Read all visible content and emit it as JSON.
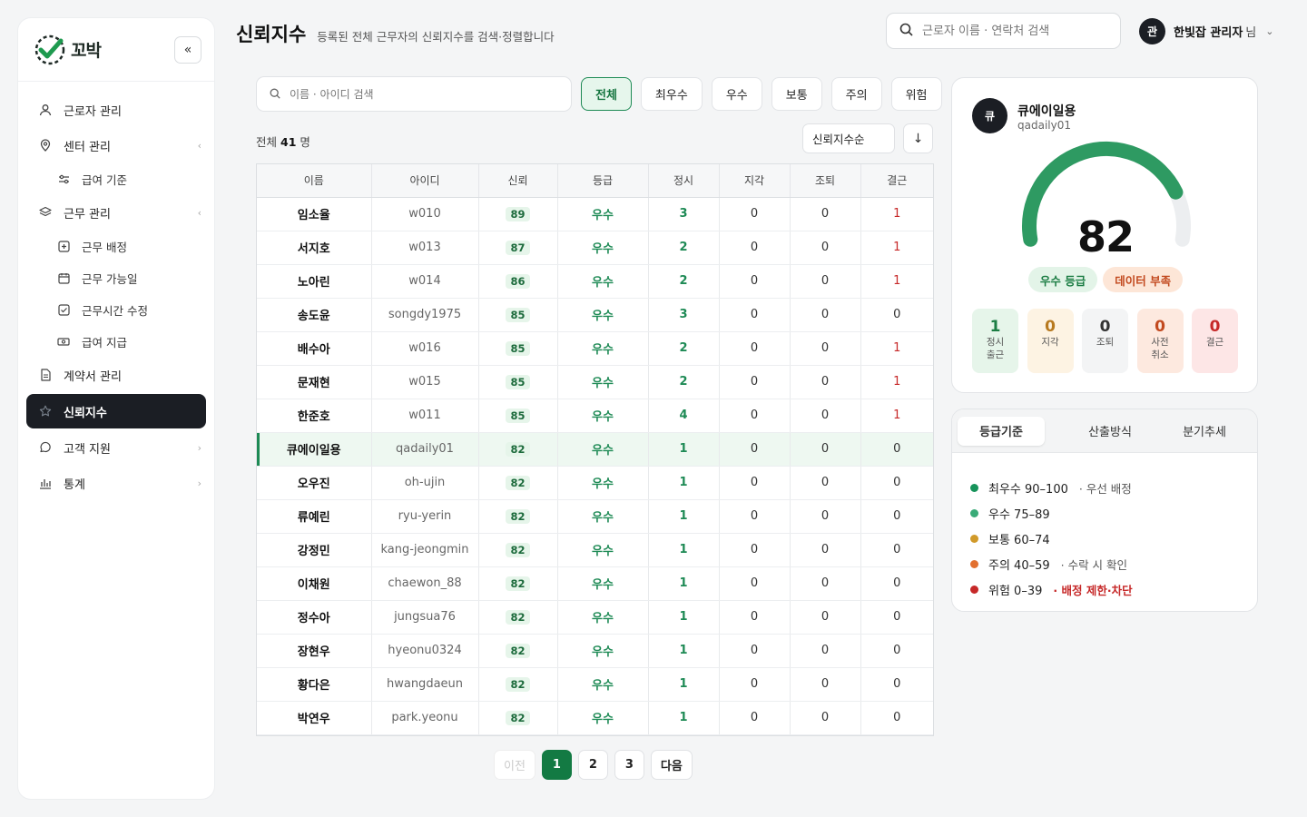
{
  "app": {
    "logo_text": "꼬박"
  },
  "sidebar": {
    "items": [
      {
        "label": "근로자 관리"
      },
      {
        "label": "센터 관리"
      },
      {
        "label": "급여 기준"
      },
      {
        "label": "근무 관리"
      },
      {
        "label": "근무 배정"
      },
      {
        "label": "근무 가능일"
      },
      {
        "label": "근무시간 수정"
      },
      {
        "label": "급여 지급"
      },
      {
        "label": "계약서 관리"
      },
      {
        "label": "신뢰지수"
      },
      {
        "label": "고객 지원"
      },
      {
        "label": "통계"
      }
    ]
  },
  "header": {
    "title": "신뢰지수",
    "subtitle": "등록된 전체 근무자의 신뢰지수를 검색·정렬합니다",
    "search_placeholder": "근로자 이름 · 연락처 검색",
    "user_initial": "관",
    "user_name": "한빛잡 관리자",
    "user_suffix": "님"
  },
  "list": {
    "search_placeholder": "이름 · 아이디 검색",
    "filters": [
      "전체",
      "최우수",
      "우수",
      "보통",
      "주의",
      "위험"
    ],
    "total_prefix": "전체",
    "total_count": "41",
    "total_suffix": "명",
    "sort_label": "신뢰지수순",
    "columns": [
      "이름",
      "아이디",
      "신뢰",
      "등급",
      "정시",
      "지각",
      "조퇴",
      "결근"
    ],
    "rows": [
      {
        "name": "임소율",
        "id": "w010",
        "score": "89",
        "grade": "우수",
        "ontime": "3",
        "late": "0",
        "early": "0",
        "absent": "1"
      },
      {
        "name": "서지호",
        "id": "w013",
        "score": "87",
        "grade": "우수",
        "ontime": "2",
        "late": "0",
        "early": "0",
        "absent": "1"
      },
      {
        "name": "노아린",
        "id": "w014",
        "score": "86",
        "grade": "우수",
        "ontime": "2",
        "late": "0",
        "early": "0",
        "absent": "1"
      },
      {
        "name": "송도윤",
        "id": "songdy1975",
        "score": "85",
        "grade": "우수",
        "ontime": "3",
        "late": "0",
        "early": "0",
        "absent": "0"
      },
      {
        "name": "배수아",
        "id": "w016",
        "score": "85",
        "grade": "우수",
        "ontime": "2",
        "late": "0",
        "early": "0",
        "absent": "1"
      },
      {
        "name": "문재현",
        "id": "w015",
        "score": "85",
        "grade": "우수",
        "ontime": "2",
        "late": "0",
        "early": "0",
        "absent": "1"
      },
      {
        "name": "한준호",
        "id": "w011",
        "score": "85",
        "grade": "우수",
        "ontime": "4",
        "late": "0",
        "early": "0",
        "absent": "1"
      },
      {
        "name": "큐에이일용",
        "id": "qadaily01",
        "score": "82",
        "grade": "우수",
        "ontime": "1",
        "late": "0",
        "early": "0",
        "absent": "0"
      },
      {
        "name": "오우진",
        "id": "oh-ujin",
        "score": "82",
        "grade": "우수",
        "ontime": "1",
        "late": "0",
        "early": "0",
        "absent": "0"
      },
      {
        "name": "류예린",
        "id": "ryu-yerin",
        "score": "82",
        "grade": "우수",
        "ontime": "1",
        "late": "0",
        "early": "0",
        "absent": "0"
      },
      {
        "name": "강정민",
        "id": "kang-jeongmin",
        "score": "82",
        "grade": "우수",
        "ontime": "1",
        "late": "0",
        "early": "0",
        "absent": "0"
      },
      {
        "name": "이채원",
        "id": "chaewon_88",
        "score": "82",
        "grade": "우수",
        "ontime": "1",
        "late": "0",
        "early": "0",
        "absent": "0"
      },
      {
        "name": "정수아",
        "id": "jungsua76",
        "score": "82",
        "grade": "우수",
        "ontime": "1",
        "late": "0",
        "early": "0",
        "absent": "0"
      },
      {
        "name": "장현우",
        "id": "hyeonu0324",
        "score": "82",
        "grade": "우수",
        "ontime": "1",
        "late": "0",
        "early": "0",
        "absent": "0"
      },
      {
        "name": "황다은",
        "id": "hwangdaeun",
        "score": "82",
        "grade": "우수",
        "ontime": "1",
        "late": "0",
        "early": "0",
        "absent": "0"
      },
      {
        "name": "박연우",
        "id": "park.yeonu",
        "score": "82",
        "grade": "우수",
        "ontime": "1",
        "late": "0",
        "early": "0",
        "absent": "0"
      }
    ],
    "pagination": {
      "prev": "이전",
      "pages": [
        "1",
        "2",
        "3"
      ],
      "next": "다음"
    }
  },
  "detail": {
    "initial": "큐",
    "name": "큐에이일용",
    "id": "qadaily01",
    "score": "82",
    "badge_grade": "우수 등급",
    "badge_warn": "데이터 부족",
    "stats": [
      {
        "value": "1",
        "label": "정시 출근"
      },
      {
        "value": "0",
        "label": "지각"
      },
      {
        "value": "0",
        "label": "조퇴"
      },
      {
        "value": "0",
        "label": "사전 취소"
      },
      {
        "value": "0",
        "label": "결근"
      }
    ]
  },
  "grade_panel": {
    "tabs": [
      "등급기준",
      "산출방식",
      "분기추세"
    ],
    "legend": [
      {
        "label": "최우수 90–100",
        "note": "· 우선 배정"
      },
      {
        "label": "우수 75–89",
        "note": ""
      },
      {
        "label": "보통 60–74",
        "note": ""
      },
      {
        "label": "주의 40–59",
        "note": "· 수락 시 확인"
      },
      {
        "label": "위험 0–39",
        "note": "· 배정 제한·차단"
      }
    ]
  },
  "colors": {
    "accent": "#137a43",
    "grade_green": "#1e8a55",
    "danger": "#c62828",
    "gauge_track": "#eceef0"
  }
}
